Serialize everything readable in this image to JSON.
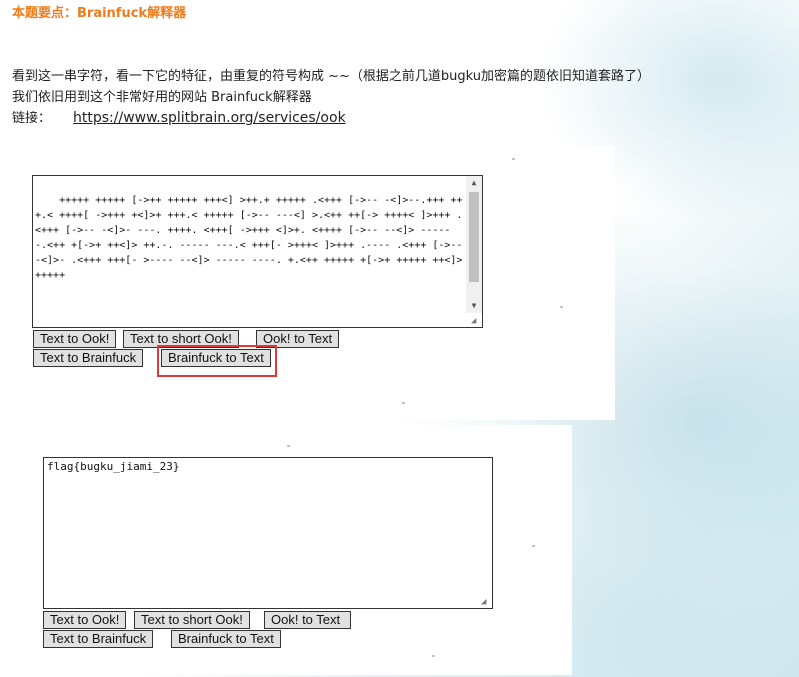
{
  "heading": "本题要点：Brainfuck解释器",
  "intro": {
    "line1": "看到这一串字符，看一下它的特征，由重复的符号构成 ~~（根据之前几道bugku加密篇的题依旧知道套路了）",
    "line2": "我们依旧用到这个非常好用的网站  Brainfuck解释器",
    "line3_label": "链接：",
    "line3_link": "https://www.splitbrain.org/services/ook"
  },
  "panel1": {
    "textarea": "+++++ +++++ [->++ +++++ +++<] >++.+ +++++ .<+++ [->-- -<]>--.+++ +++.< ++++[ ->+++ +<]>+ +++.< +++++ [->-- ---<] >.<++ ++[-> ++++< ]>+++ .<+++ [->-- -<]>- ---. ++++. <+++[ ->+++ <]>+. <++++ [->-- --<]> ----- -.<++ +[->+ ++<]> ++.-. ----- ---.< +++[- >+++< ]>+++ .---- .<+++ [->-- -<]>- .<+++ +++[- >---- --<]> ----- ----. +.<++ +++++ +[->+ +++++ ++<]> +++++",
    "buttons": {
      "text_to_ook": "Text to Ook!",
      "text_to_short_ook": "Text to short Ook!",
      "ook_to_text": "Ook! to Text",
      "text_to_brainfuck": "Text to Brainfuck",
      "brainfuck_to_text": "Brainfuck to Text"
    }
  },
  "panel2": {
    "textarea": "flag{bugku_jiami_23}",
    "buttons": {
      "text_to_ook": "Text to Ook!",
      "text_to_short_ook": "Text to short Ook!",
      "ook_to_text": "Ook! to Text",
      "text_to_brainfuck": "Text to Brainfuck",
      "brainfuck_to_text": "Brainfuck to Text"
    }
  },
  "colors": {
    "heading": "#f07b1a",
    "highlight": "#e23b35"
  }
}
